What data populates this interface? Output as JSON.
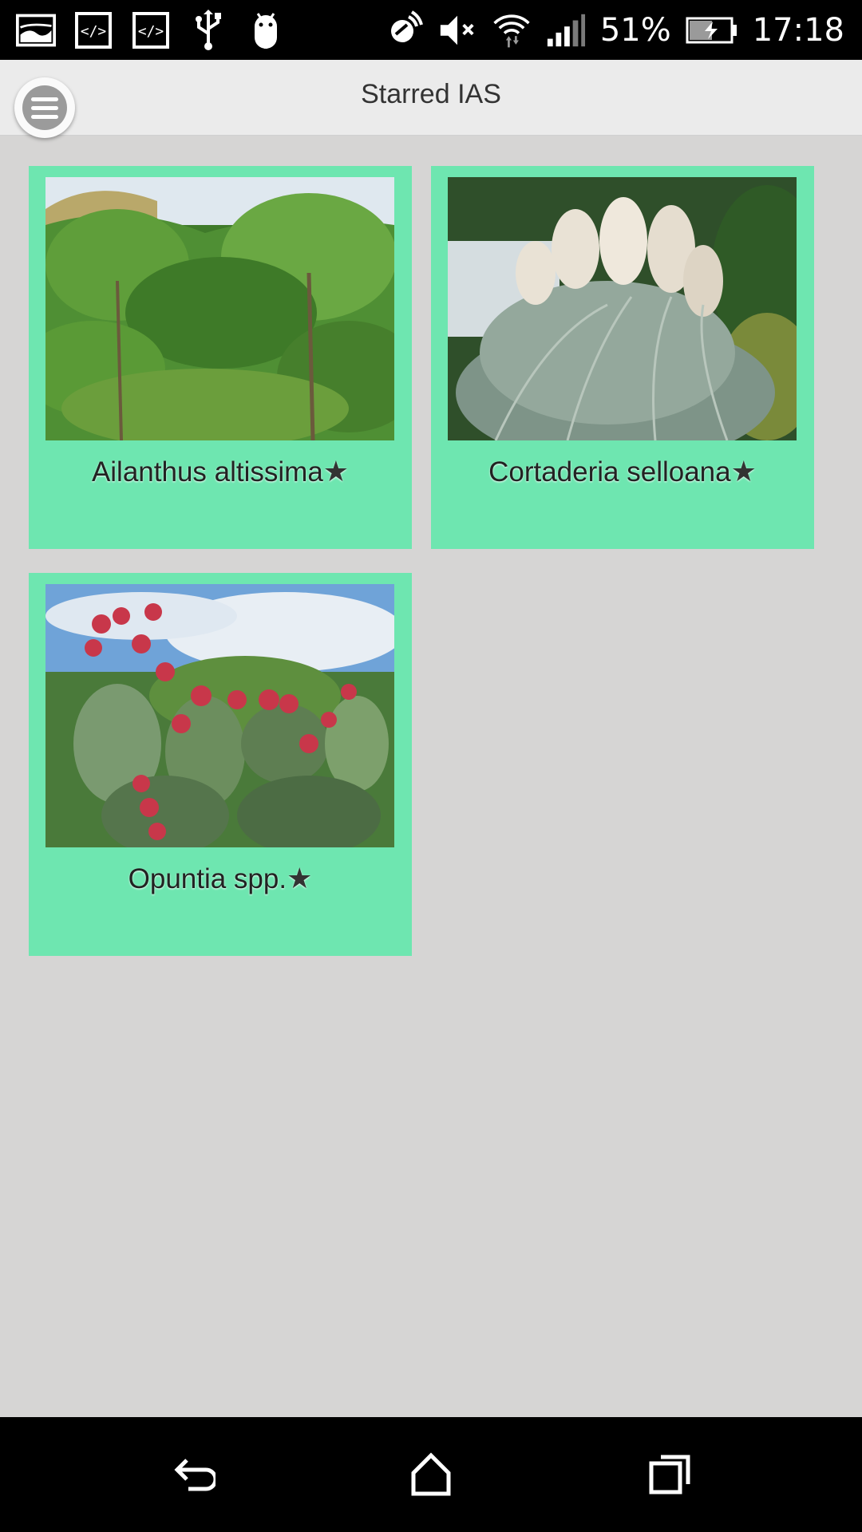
{
  "status_bar": {
    "battery_percent": "51%",
    "time": "17:18",
    "left_icons": [
      "gallery-icon",
      "code-icon",
      "code-icon",
      "usb-icon",
      "android-icon"
    ],
    "right_icons": [
      "nfc-icon",
      "mute-icon",
      "wifi-icon",
      "signal-icon",
      "battery-charging-icon"
    ]
  },
  "app_bar": {
    "title": "Starred IAS",
    "menu_icon": "hamburger-menu-icon"
  },
  "cards": [
    {
      "label": "Ailanthus altissima",
      "star": "★",
      "image": "tree-of-heaven-photo"
    },
    {
      "label": "Cortaderia selloana",
      "star": "★",
      "image": "pampas-grass-photo"
    },
    {
      "label": "Opuntia spp.",
      "star": "★",
      "image": "prickly-pear-cactus-photo"
    }
  ],
  "nav_bar": {
    "buttons": [
      "back-icon",
      "home-icon",
      "recents-icon"
    ]
  },
  "colors": {
    "card_bg": "#6ee6b0",
    "page_bg": "#d6d5d4",
    "app_bar_bg": "#ebebeb"
  }
}
